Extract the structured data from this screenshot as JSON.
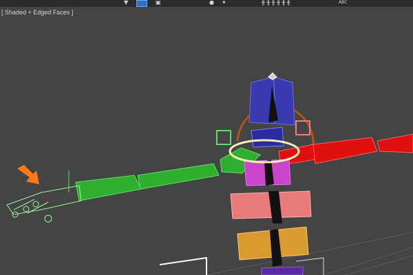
{
  "viewport": {
    "label": "[ Shaded + Edged Faces ]"
  },
  "toolbar": {
    "icons": [
      "select-object-icon",
      "selection-region-icon",
      "move-icon",
      "rotate-icon",
      "link-icon",
      "bone-tools-icon",
      "text-abc-icon"
    ],
    "text_icon_label": "ABC"
  },
  "scene": {
    "annotation_arrow_color": "#ff7a1a",
    "left_arm_color": "#33cc33",
    "right_arm_color": "#e01010",
    "spine_color": "#3a3ab0",
    "pelvis_color": "#e87a7a",
    "legs_color": "#d99a30",
    "neck_color": "#cc44cc",
    "rotate_gizmo_color": "#f5eeb8",
    "head_ring_color": "#b5521a"
  }
}
